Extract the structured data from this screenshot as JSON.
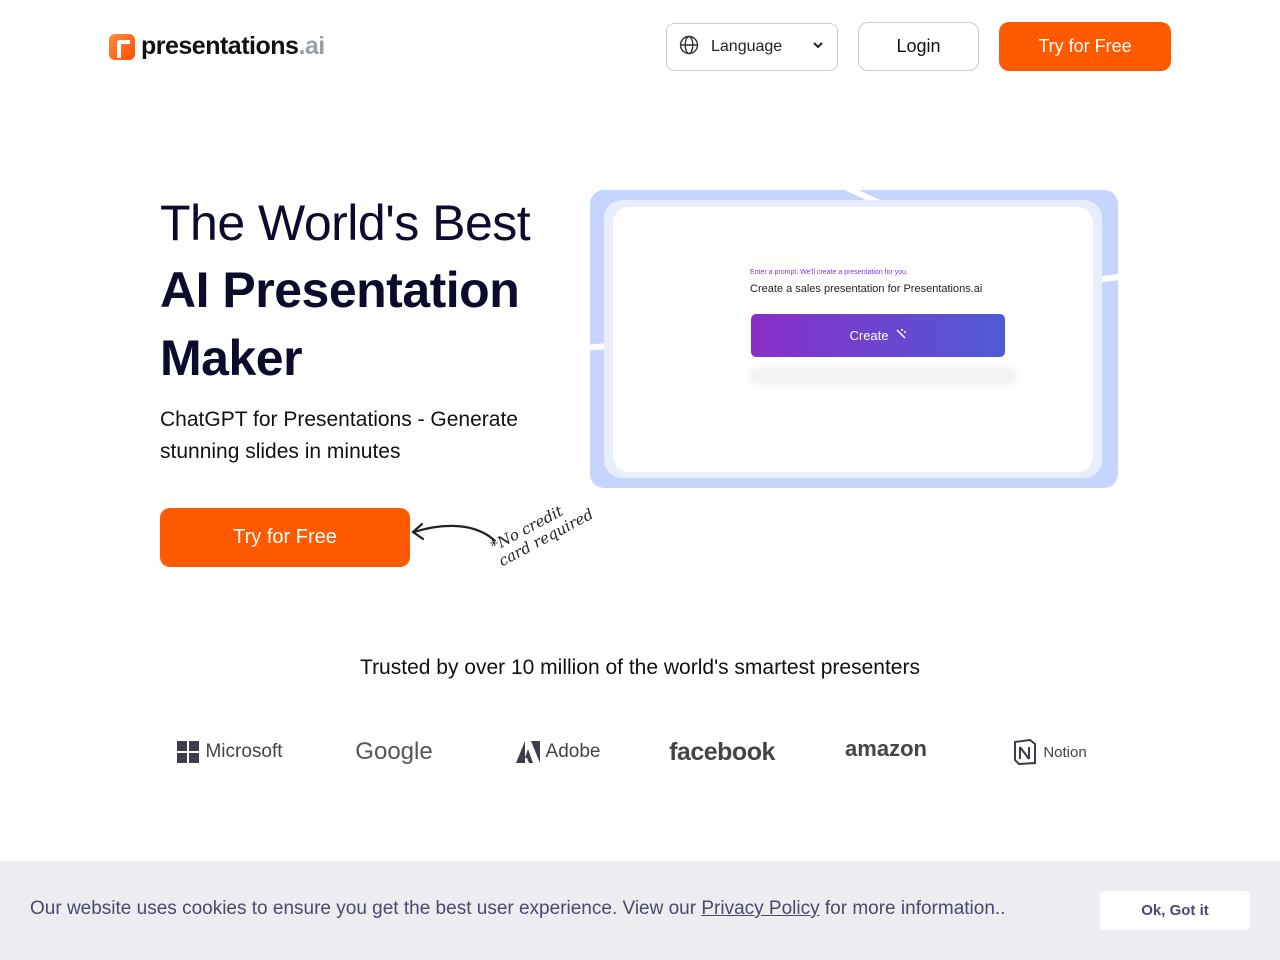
{
  "header": {
    "logo_text": "presentations",
    "logo_suffix": ".ai",
    "language_label": "Language",
    "login_label": "Login",
    "try_label": "Try for Free"
  },
  "hero": {
    "title_line1": "The World's Best",
    "title_line2": "AI Presentation",
    "title_line3": "Maker",
    "subtitle": "ChatGPT for Presentations - Generate stunning slides in minutes",
    "cta_label": "Try for Free",
    "note": "*No credit card required"
  },
  "preview": {
    "prompt_hint": "Enter a prompt. We'll create a presentation for you.",
    "prompt_text": "Create a sales presentation for Presentations.ai",
    "create_label": "Create"
  },
  "trusted": {
    "text": "Trusted by over 10 million of the world's smartest presenters",
    "brands": [
      "Microsoft",
      "Google",
      "Adobe",
      "facebook",
      "amazon",
      "Notion"
    ]
  },
  "cookie": {
    "text_before": "Our website uses cookies to ensure you get the best user experience. View our ",
    "link_label": "Privacy Policy",
    "text_after": " for more information..",
    "ok_label": "Ok, Got it"
  },
  "colors": {
    "accent": "#ff5a00",
    "preview_bg": "#c5d5ff",
    "create_gradient_start": "#8a2ec9",
    "create_gradient_end": "#4f5bd5",
    "cookie_bg": "#ececf1"
  },
  "icons": {
    "language": "globe-icon",
    "dropdown": "chevron-down-icon",
    "create": "magic-wand-icon"
  }
}
